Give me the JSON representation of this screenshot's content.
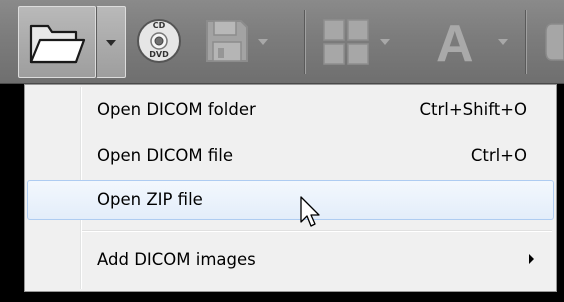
{
  "toolbar": {
    "open_button_icon": "folder-open-icon",
    "open_dropdown_icon": "chevron-down-icon",
    "cd_button_icon": "cd-dvd-icon",
    "cd_label_top": "CD",
    "cd_label_bottom": "DVD",
    "save_button_icon": "floppy-disk-icon",
    "layout_button_icon": "grid-layout-icon",
    "font_button_icon": "font-letter-icon",
    "font_letter": "A"
  },
  "menu": {
    "items": [
      {
        "label": "Open DICOM folder",
        "shortcut": "Ctrl+Shift+O"
      },
      {
        "label": "Open DICOM file",
        "shortcut": "Ctrl+O"
      },
      {
        "label": "Open ZIP file",
        "shortcut": ""
      },
      {
        "label": "Add DICOM images",
        "shortcut": ""
      }
    ],
    "highlighted_index": 2,
    "submenu_icon": "chevron-right-icon"
  },
  "colors": {
    "toolbar_bg": "#7c7c7c",
    "menu_bg": "#f0f0f0",
    "highlight_border": "#aeccf1",
    "highlight_fill": "#e3edfa"
  }
}
